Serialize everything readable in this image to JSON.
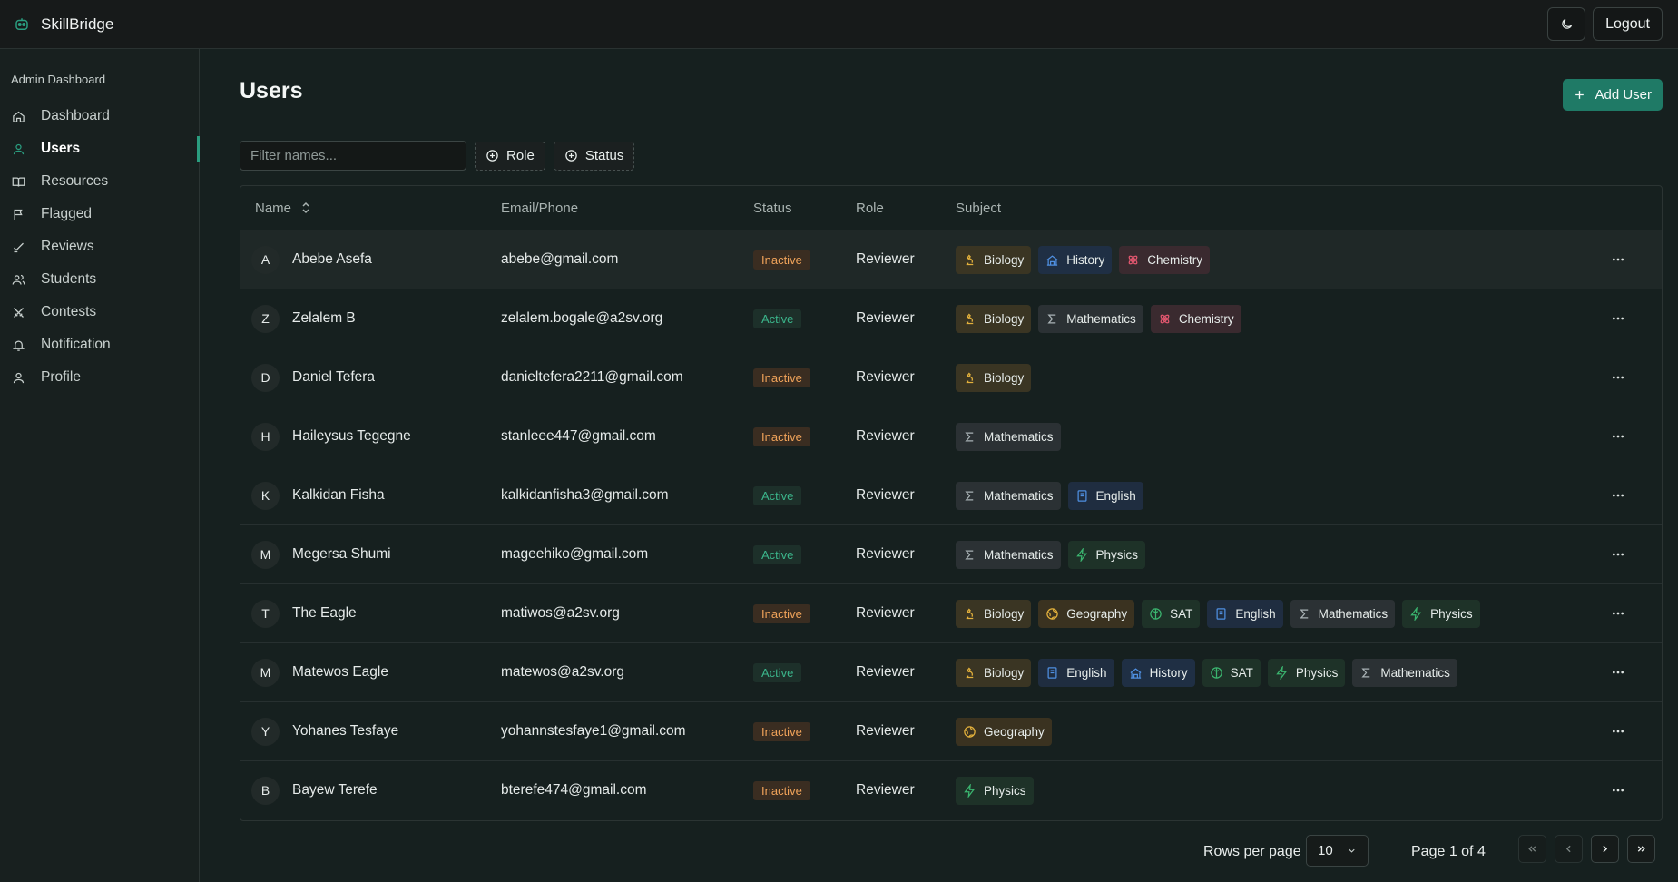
{
  "app": {
    "name": "SkillBridge",
    "logout_label": "Logout"
  },
  "sidebar": {
    "title": "Admin Dashboard",
    "items": [
      {
        "label": "Dashboard",
        "icon": "home-icon"
      },
      {
        "label": "Users",
        "icon": "user-icon",
        "active": true
      },
      {
        "label": "Resources",
        "icon": "book-icon"
      },
      {
        "label": "Flagged",
        "icon": "flag-icon"
      },
      {
        "label": "Reviews",
        "icon": "check-icon"
      },
      {
        "label": "Students",
        "icon": "users-icon"
      },
      {
        "label": "Contests",
        "icon": "swords-icon"
      },
      {
        "label": "Notification",
        "icon": "bell-icon"
      },
      {
        "label": "Profile",
        "icon": "profile-icon"
      }
    ]
  },
  "main": {
    "title": "Users",
    "add_user_label": "Add User",
    "filter_placeholder": "Filter names...",
    "role_filter_label": "Role",
    "status_filter_label": "Status"
  },
  "table": {
    "columns": {
      "name": "Name",
      "email": "Email/Phone",
      "status": "Status",
      "role": "Role",
      "subject": "Subject"
    },
    "rows": [
      {
        "initial": "A",
        "name": "Abebe Asefa",
        "email": "abebe@gmail.com",
        "status": "Inactive",
        "role": "Reviewer",
        "subjects": [
          "Biology",
          "History",
          "Chemistry"
        ]
      },
      {
        "initial": "Z",
        "name": "Zelalem B",
        "email": "zelalem.bogale@a2sv.org",
        "status": "Active",
        "role": "Reviewer",
        "subjects": [
          "Biology",
          "Mathematics",
          "Chemistry"
        ]
      },
      {
        "initial": "D",
        "name": "Daniel Tefera",
        "email": "danieltefera2211@gmail.com",
        "status": "Inactive",
        "role": "Reviewer",
        "subjects": [
          "Biology"
        ]
      },
      {
        "initial": "H",
        "name": "Haileysus Tegegne",
        "email": "stanleee447@gmail.com",
        "status": "Inactive",
        "role": "Reviewer",
        "subjects": [
          "Mathematics"
        ]
      },
      {
        "initial": "K",
        "name": "Kalkidan Fisha",
        "email": "kalkidanfisha3@gmail.com",
        "status": "Active",
        "role": "Reviewer",
        "subjects": [
          "Mathematics",
          "English"
        ]
      },
      {
        "initial": "M",
        "name": "Megersa Shumi",
        "email": "mageehiko@gmail.com",
        "status": "Active",
        "role": "Reviewer",
        "subjects": [
          "Mathematics",
          "Physics"
        ]
      },
      {
        "initial": "T",
        "name": "The Eagle",
        "email": "matiwos@a2sv.org",
        "status": "Inactive",
        "role": "Reviewer",
        "subjects": [
          "Biology",
          "Geography",
          "SAT",
          "English",
          "Mathematics",
          "Physics"
        ]
      },
      {
        "initial": "M",
        "name": "Matewos Eagle",
        "email": "matewos@a2sv.org",
        "status": "Active",
        "role": "Reviewer",
        "subjects": [
          "Biology",
          "English",
          "History",
          "SAT",
          "Physics",
          "Mathematics"
        ]
      },
      {
        "initial": "Y",
        "name": "Yohanes Tesfaye",
        "email": "yohannstesfaye1@gmail.com",
        "status": "Inactive",
        "role": "Reviewer",
        "subjects": [
          "Geography"
        ]
      },
      {
        "initial": "B",
        "name": "Bayew Terefe",
        "email": "bterefe474@gmail.com",
        "status": "Inactive",
        "role": "Reviewer",
        "subjects": [
          "Physics"
        ]
      }
    ]
  },
  "pagination": {
    "rows_per_page_label": "Rows per page",
    "rows_per_page_value": "10",
    "page_label": "Page 1 of 4"
  },
  "colors": {
    "accent": "#1f7a66",
    "inactive": "#f0a35a",
    "active": "#3bb58b"
  }
}
